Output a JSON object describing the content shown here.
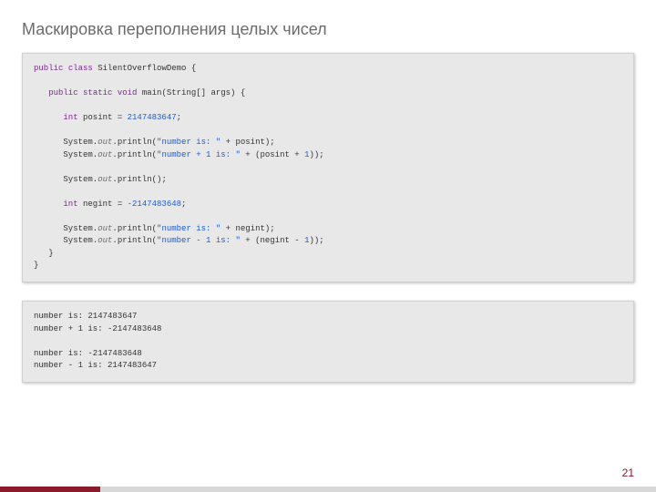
{
  "title": "Маскировка переполнения целых чисел",
  "page_number": "21",
  "code": {
    "class_name": "SilentOverflowDemo",
    "posint_value": "2147483647",
    "negint_value": "-2147483648",
    "str_number_is": "\"number is: \"",
    "str_number_plus1": "\"number + 1 is: \"",
    "str_number_minus1": "\"number - 1 is: \"",
    "kw_public": "public",
    "kw_class": "class",
    "kw_static": "static",
    "kw_void": "void",
    "kw_int": "int",
    "main_sig": "main(String[] args) {",
    "sys": "System.",
    "out": "out",
    "println": ".println"
  },
  "output": {
    "l1": "number is: 2147483647",
    "l2": "number + 1 is: -2147483648",
    "l3": "",
    "l4": "number is: -2147483648",
    "l5": "number - 1 is: 2147483647"
  }
}
